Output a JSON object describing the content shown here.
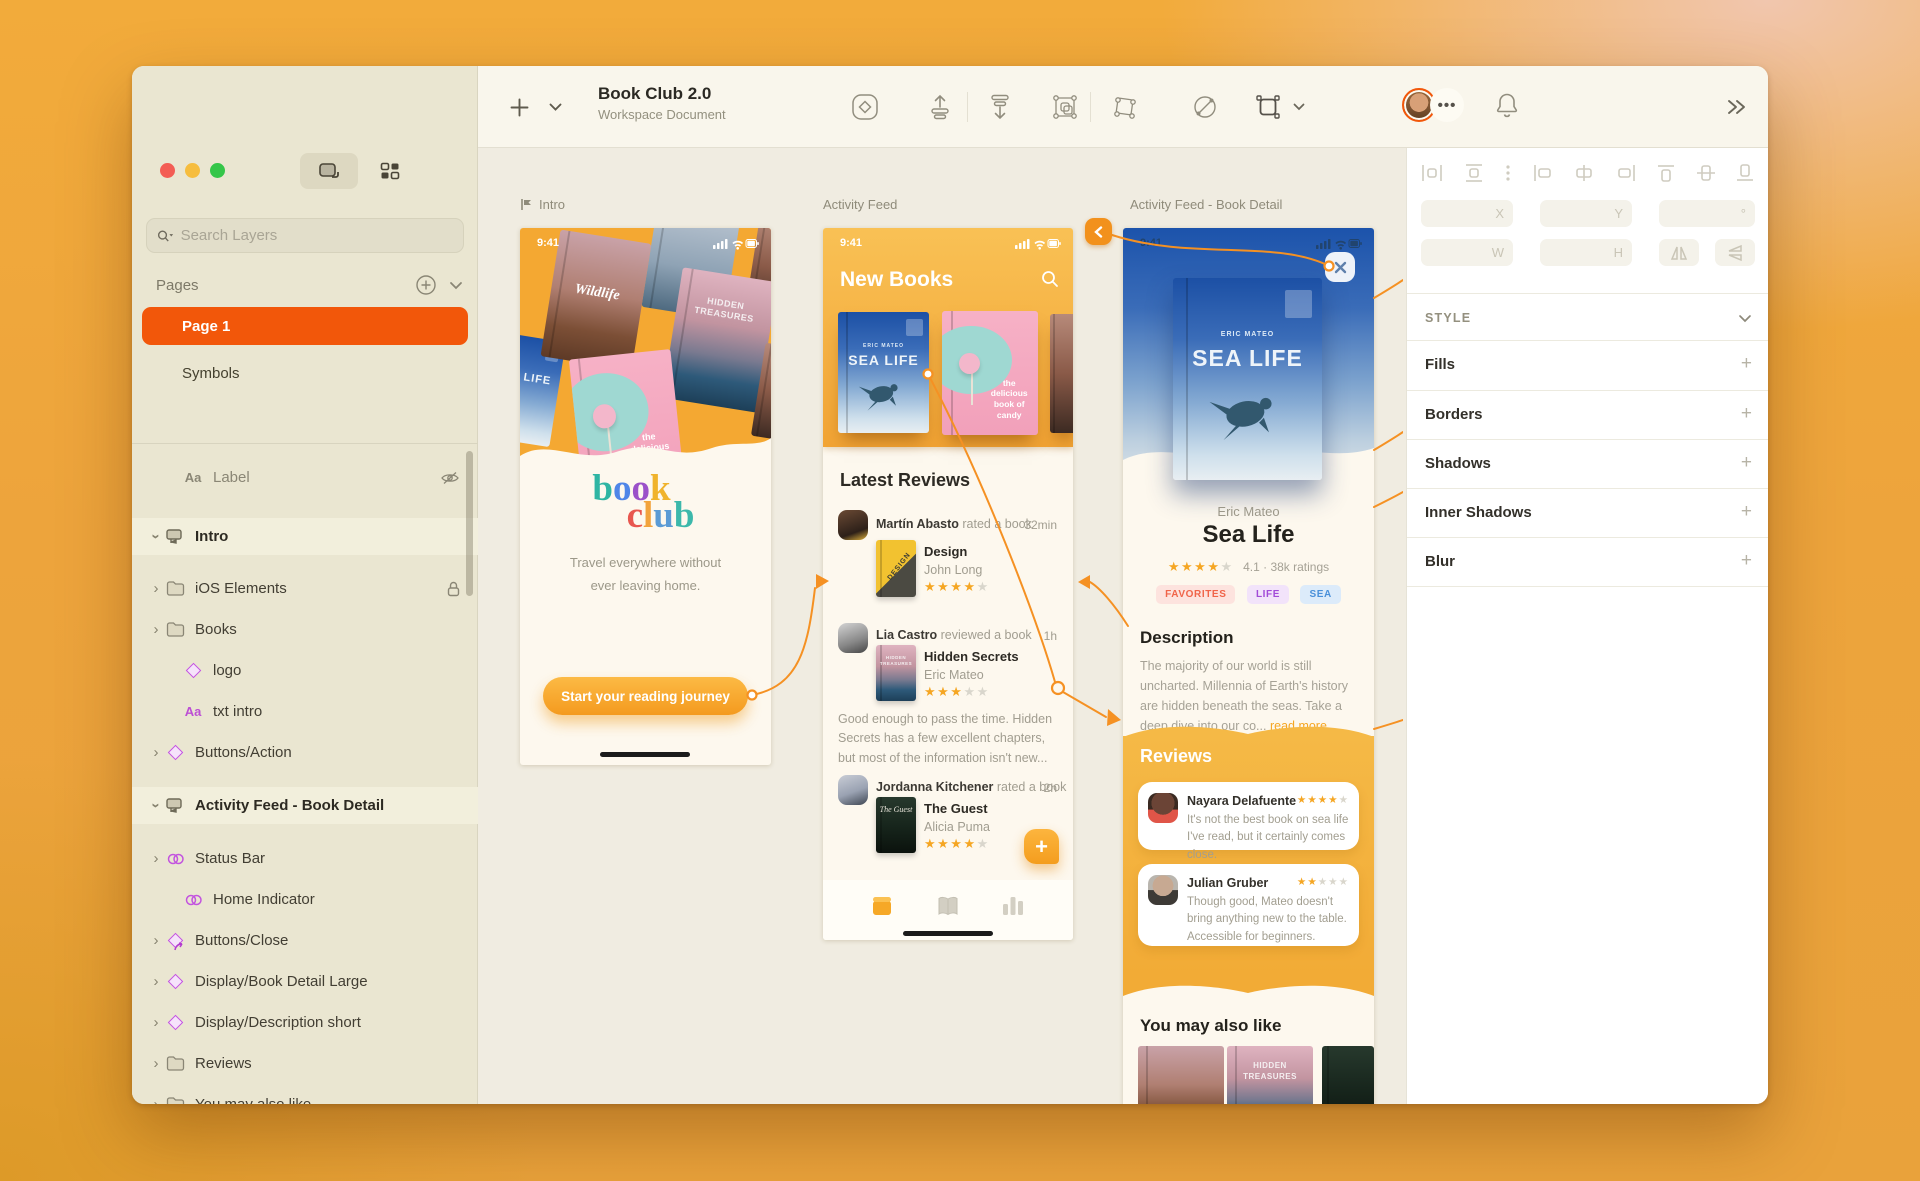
{
  "colors": {
    "accent_orange": "#F2570A",
    "connector_orange": "#F59123",
    "star_orange": "#F5A623",
    "app_header_orange": "#F5A82C",
    "symbol_purple": "#C353DF",
    "sidebar_bg": "#EAE6D1",
    "toolbar_bg": "#F9F6EC",
    "canvas_bg": "#F0ECE1",
    "tag_favorites": "#F06449",
    "tag_life": "#A24BD8",
    "tag_sea": "#4A90D9"
  },
  "toolbar": {
    "title": "Book Club 2.0",
    "subtitle": "Workspace Document"
  },
  "sidebar": {
    "search_placeholder": "Search Layers",
    "pages_label": "Pages",
    "pages": [
      "Page 1",
      "Symbols"
    ],
    "label_row": "Label",
    "layers": [
      {
        "label": "Intro"
      },
      {
        "label": "iOS Elements"
      },
      {
        "label": "Books"
      },
      {
        "label": "logo"
      },
      {
        "label": "txt intro"
      },
      {
        "label": "Buttons/Action"
      },
      {
        "label": "Activity Feed - Book Detail"
      },
      {
        "label": "Status Bar"
      },
      {
        "label": "Home Indicator"
      },
      {
        "label": "Buttons/Close"
      },
      {
        "label": "Display/Book Detail Large"
      },
      {
        "label": "Display/Description short"
      },
      {
        "label": "Reviews"
      },
      {
        "label": "You may also like"
      }
    ]
  },
  "inspector": {
    "style_label": "STYLE",
    "fields": {
      "x": "X",
      "y": "Y",
      "w": "W",
      "h": "H",
      "deg": "°"
    },
    "sections": [
      "Fills",
      "Borders",
      "Shadows",
      "Inner Shadows",
      "Blur"
    ]
  },
  "canvas": {
    "status_time": "9:41",
    "artboards": {
      "intro": {
        "title": "Intro",
        "letters": [
          "b",
          "o",
          "o",
          "k",
          "c",
          "l",
          "u",
          "b"
        ],
        "tagline1": "Travel everywhere without",
        "tagline2": "ever leaving home.",
        "cta": "Start your reading journey"
      },
      "feed": {
        "title": "Activity Feed",
        "header": "New Books",
        "section": "Latest Reviews",
        "reviews": [
          {
            "name": "Martín Abasto",
            "action": "rated a book",
            "time": "32min",
            "book": "Design",
            "author": "John Long",
            "stars": "★★★★",
            "stars_empty": "★"
          },
          {
            "name": "Lia Castro",
            "action": "reviewed a book",
            "time": "1h",
            "book": "Hidden Secrets",
            "author": "Eric Mateo",
            "stars": "★★★",
            "stars_empty": "★★",
            "text": "Good enough to pass the time. Hidden Secrets has a few excellent chapters, but most of the information isn't new..."
          },
          {
            "name": "Jordanna Kitchener",
            "action": "rated a book",
            "time": "2h",
            "book": "The Guest",
            "author": "Alicia Puma",
            "stars": "★★★★",
            "stars_empty": "★"
          }
        ]
      },
      "detail": {
        "title": "Activity Feed - Book Detail",
        "author": "Eric Mateo",
        "book": "Sea Life",
        "stars": "★★★★",
        "stars_empty": "★",
        "rating": "4.1 · 38k ratings",
        "tags": [
          "FAVORITES",
          "LIFE",
          "SEA"
        ],
        "desc_heading": "Description",
        "desc": "The majority of our world is still uncharted. Millennia of Earth's history are hidden beneath the seas. Take a deep dive into our co... ",
        "read_more": "read more",
        "reviews_heading": "Reviews",
        "reviews": [
          {
            "name": "Nayara Delafuente",
            "stars": "★★★★",
            "stars_empty": "★",
            "text": "It's not the best book on sea life I've read, but it certainly comes close."
          },
          {
            "name": "Julian Gruber",
            "stars": "★★",
            "stars_empty": "★★★",
            "text": "Though good, Mateo doesn't bring anything new to the table. Accessible for beginners."
          }
        ],
        "also_heading": "You may also like"
      }
    },
    "covers": {
      "sea_life": "SEA LIFE",
      "sea_life_author": "ERIC MATEO",
      "candy": "the delicious book of candy",
      "hidden_treasures": "HIDDEN TREASURES",
      "wildlife": "Wildlife",
      "design": "DESIGN",
      "guest": "The Guest"
    }
  }
}
